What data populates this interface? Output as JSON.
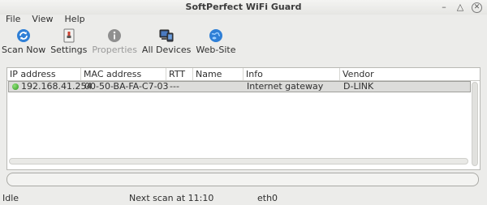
{
  "window": {
    "title": "SoftPerfect WiFi Guard",
    "controls": [
      "–",
      "△",
      "✕"
    ]
  },
  "menu": [
    "File",
    "View",
    "Help"
  ],
  "toolbar": [
    {
      "label": "Scan Now",
      "icon": "refresh-icon",
      "enabled": true
    },
    {
      "label": "Settings",
      "icon": "settings-icon",
      "enabled": true
    },
    {
      "label": "Properties",
      "icon": "info-icon",
      "enabled": false
    },
    {
      "label": "All Devices",
      "icon": "devices-icon",
      "enabled": true
    },
    {
      "label": "Web-Site",
      "icon": "globe-icon",
      "enabled": true
    }
  ],
  "table": {
    "columns": [
      "IP address",
      "MAC address",
      "RTT",
      "Name",
      "Info",
      "Vendor"
    ],
    "rows": [
      {
        "status": "online",
        "ip": "192.168.41.254",
        "mac": "00-50-BA-FA-C7-03",
        "rtt": "---",
        "name": "",
        "info": "Internet gateway",
        "vendor": "D-LINK"
      }
    ]
  },
  "progress": {
    "value": 0
  },
  "statusbar": {
    "state": "Idle",
    "next_scan": "Next scan at 11:10",
    "interface": "eth0"
  },
  "colors": {
    "accent": "#3b7fd0",
    "online": "#2f9a1f",
    "selection": "#dcdcda"
  }
}
